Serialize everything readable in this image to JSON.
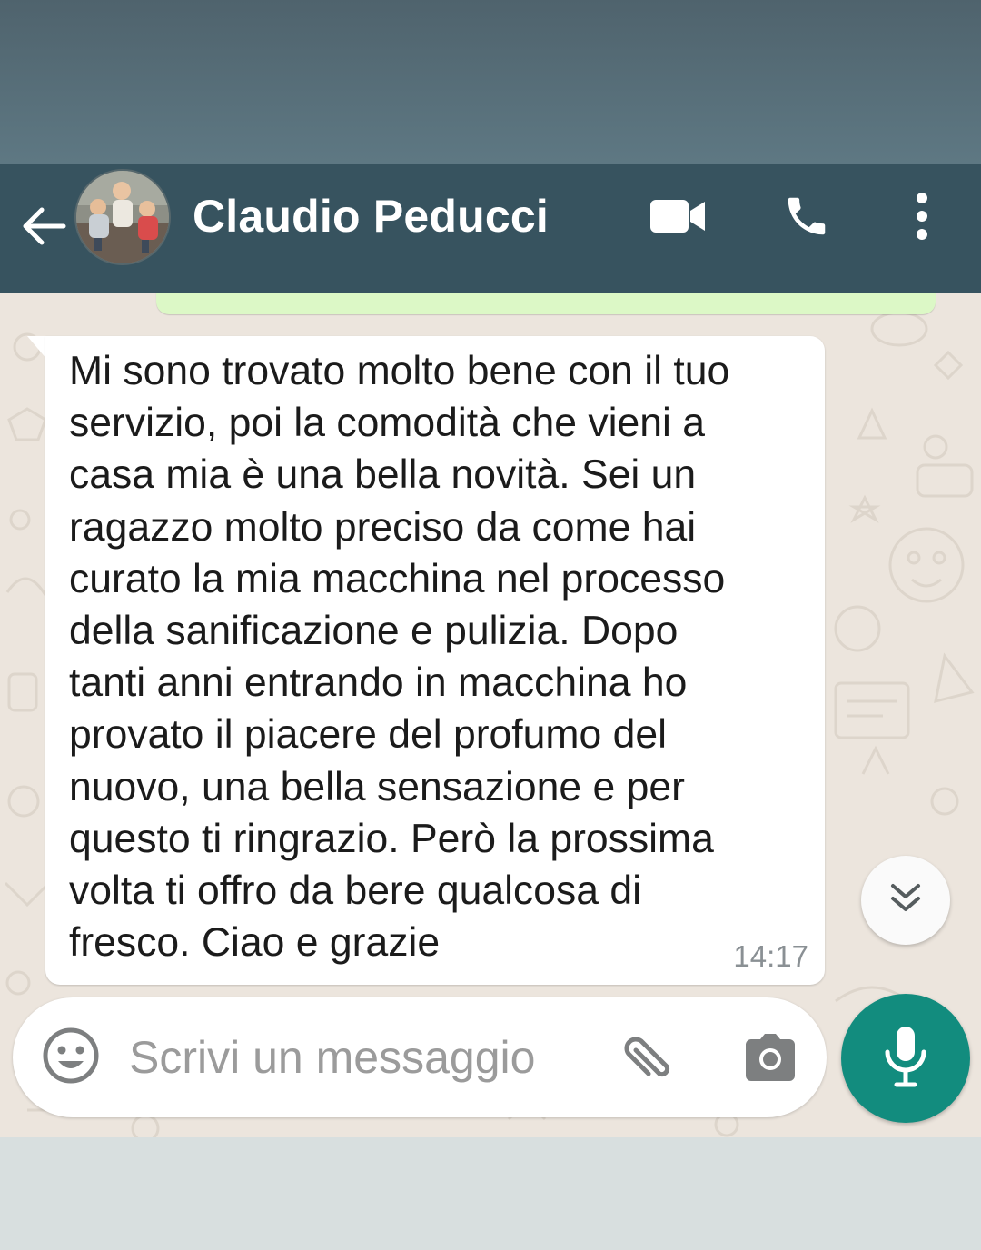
{
  "header": {
    "contact_name": "Claudio Peducci",
    "back_icon": "arrow-left-icon",
    "video_icon": "video-camera-icon",
    "call_icon": "phone-icon",
    "menu_icon": "more-vertical-icon",
    "background_color": "#37535f"
  },
  "chat": {
    "messages": [
      {
        "direction": "incoming",
        "text": "Mi sono trovato molto bene con il tuo\nservizio, poi la comodità che vieni a\ncasa mia è una bella novità. Sei un\nragazzo molto preciso da come hai\ncurato la mia macchina nel processo\ndella sanificazione e pulizia. Dopo\ntanti anni entrando in macchina ho\nprovato il piacere del profumo del\nnuovo, una bella sensazione e per\nquesto ti ringrazio. Però la prossima\nvolta ti offro da bere qualcosa di\nfresco. Ciao e grazie",
        "time": "14:17"
      }
    ],
    "scroll_down_icon": "double-chevron-down-icon",
    "wallpaper_color": "#ece5dd",
    "outgoing_bubble_color": "#dcf8c6"
  },
  "composer": {
    "placeholder": "Scrivi un messaggio",
    "emoji_icon": "emoji-smile-icon",
    "attach_icon": "paperclip-icon",
    "camera_icon": "camera-icon",
    "mic_icon": "microphone-icon",
    "accent_color": "#128c7e"
  }
}
